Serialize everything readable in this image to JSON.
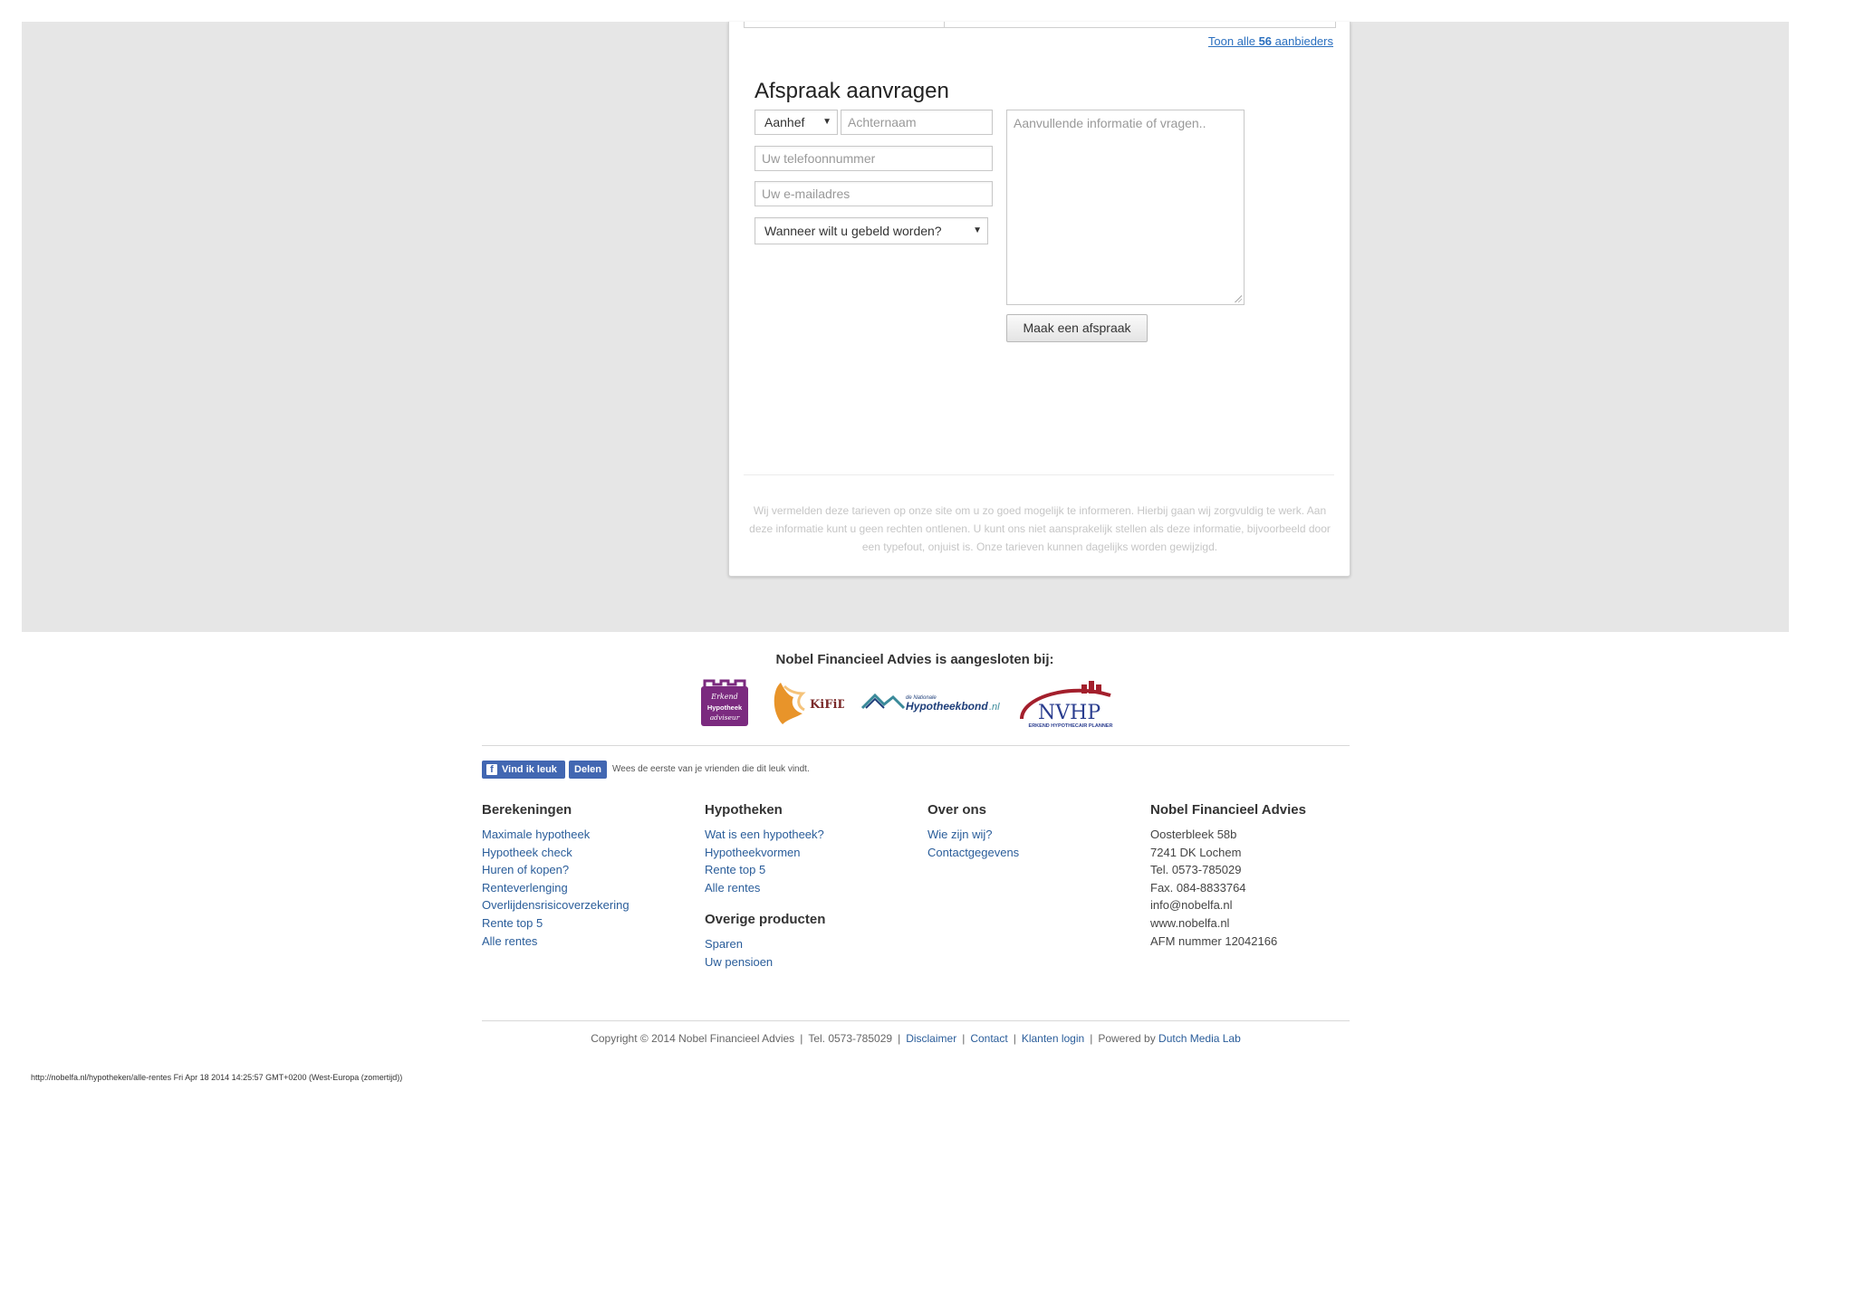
{
  "listing": {
    "link_prefix": "Toon alle ",
    "link_count": "56",
    "link_suffix": " aanbieders"
  },
  "form": {
    "title": "Afspraak aanvragen",
    "salutation_selected": "Aanhef",
    "lastname_placeholder": "Achternaam",
    "phone_placeholder": "Uw telefoonnummer",
    "email_placeholder": "Uw e-mailadres",
    "callback_selected": "Wanneer wilt u gebeld worden?",
    "message_placeholder": "Aanvullende informatie of vragen..",
    "submit_label": "Maak een afspraak",
    "disclaimer": "Wij vermelden deze tarieven op onze site om u zo goed mogelijk te informeren. Hierbij gaan wij zorgvuldig te werk. Aan deze informatie kunt u geen rechten ontlenen. U kunt ons niet aansprakelijk stellen als deze informatie, bijvoorbeeld door een typefout, onjuist is. Onze tarieven kunnen dagelijks worden gewijzigd."
  },
  "affiliations": {
    "heading": "Nobel Financieel Advies is aangesloten bij:",
    "logos": [
      {
        "name": "erkend-hypotheek-adviseur",
        "lines": [
          "Erkend",
          "Hypotheek",
          "adviseur"
        ]
      },
      {
        "name": "kifid",
        "text": "KiFiD"
      },
      {
        "name": "nationale-hypotheekbond",
        "small": "de Nationale",
        "text": "Hypotheekbond",
        "suffix": ".nl"
      },
      {
        "name": "nvhp",
        "text": "NVHP",
        "sub": "ERKEND HYPOTHECAIR PLANNER"
      }
    ]
  },
  "social": {
    "like_label": "Vind ik leuk",
    "share_label": "Delen",
    "text": "Wees de eerste van je vrienden die dit leuk vindt."
  },
  "footer_columns": {
    "berekeningen": {
      "title": "Berekeningen",
      "links": [
        "Maximale hypotheek",
        "Hypotheek check",
        "Huren of kopen?",
        "Renteverlenging",
        "Overlijdensrisicoverzekering",
        "Rente top 5",
        "Alle rentes"
      ]
    },
    "hypotheken": {
      "title": "Hypotheken",
      "links": [
        "Wat is een hypotheek?",
        "Hypotheekvormen",
        "Rente top 5",
        "Alle rentes"
      ]
    },
    "overige": {
      "title": "Overige producten",
      "links": [
        "Sparen",
        "Uw pensioen"
      ]
    },
    "over_ons": {
      "title": "Over ons",
      "links": [
        "Wie zijn wij?",
        "Contactgegevens"
      ]
    },
    "contact": {
      "title": "Nobel Financieel Advies",
      "lines": [
        "Oosterbleek 58b",
        "7241 DK Lochem",
        "Tel. 0573-785029",
        "Fax. 084-8833764",
        "info@nobelfa.nl",
        "www.nobelfa.nl",
        "AFM nummer 12042166"
      ]
    }
  },
  "footer": {
    "copyright": "Copyright © 2014 Nobel Financieel Advies",
    "tel": "Tel. 0573-785029",
    "disclaimer": "Disclaimer",
    "contact": "Contact",
    "login": "Klanten login",
    "powered_by": "Powered by",
    "powered_link": "Dutch Media Lab"
  },
  "print_stamp": "http://nobelfa.nl/hypotheken/alle-rentes Fri Apr 18 2014 14:25:57 GMT+0200 (West-Europa (zomertijd))",
  "colors": {
    "link": "#2a5d9a",
    "facebook": "#4267b2",
    "kifid_orange": "#e8942a",
    "erkend_purple": "#7b2a7f",
    "nvhp_red": "#a31f2c",
    "nvhp_blue": "#2a3d8f"
  }
}
